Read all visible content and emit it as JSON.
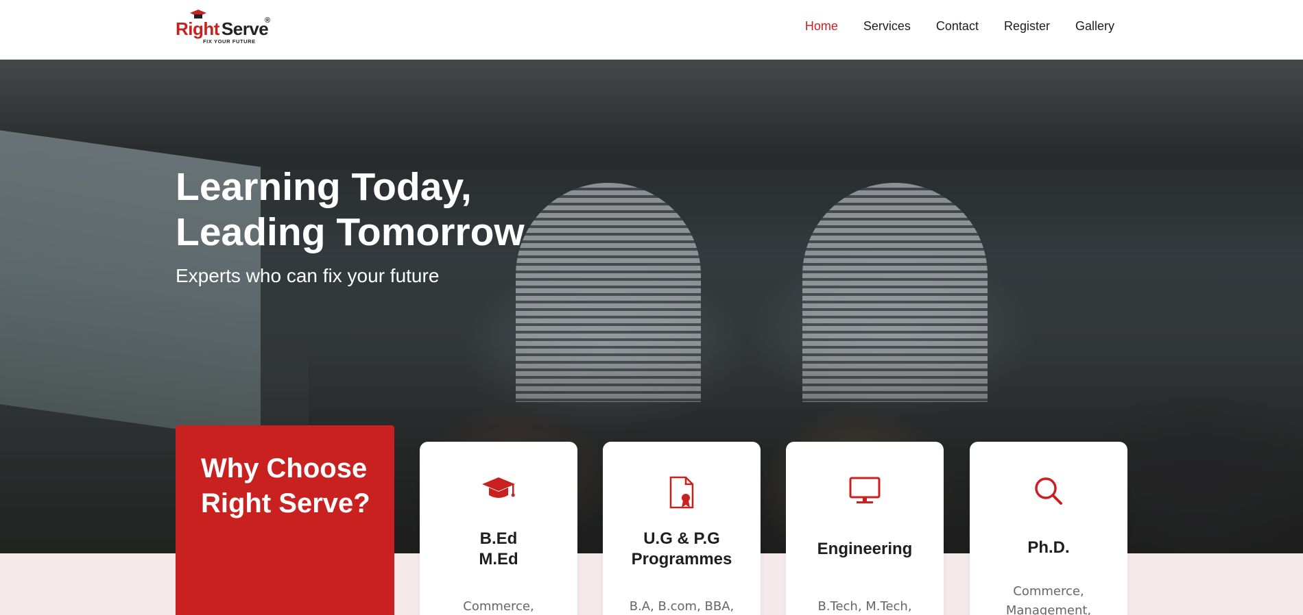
{
  "header": {
    "logo": {
      "word_right": "Right",
      "word_serve": "Serve",
      "registered": "®",
      "tagline": "FIX YOUR FUTURE"
    },
    "nav": [
      {
        "label": "Home",
        "active": true
      },
      {
        "label": "Services",
        "active": false
      },
      {
        "label": "Contact",
        "active": false
      },
      {
        "label": "Register",
        "active": false
      },
      {
        "label": "Gallery",
        "active": false
      }
    ]
  },
  "hero": {
    "title_line1": "Learning Today,",
    "title_line2": "Leading Tomorrow",
    "subtitle": "Experts who can fix your future"
  },
  "why": {
    "title": "Why Choose Right Serve?"
  },
  "cards": [
    {
      "icon": "graduation-cap-icon",
      "title": "B.Ed\nM.Ed",
      "desc": "Commerce,"
    },
    {
      "icon": "certificate-icon",
      "title": "U.G & P.G\nProgrammes",
      "desc": "B.A, B.com, BBA,"
    },
    {
      "icon": "monitor-icon",
      "title": "Engineering",
      "desc": "B.Tech, M.Tech,"
    },
    {
      "icon": "search-icon",
      "title": "Ph.D.",
      "desc": "Commerce,\nManagement,"
    }
  ],
  "colors": {
    "brand_red": "#c8211f",
    "page_bg": "#f5e9ec",
    "text_dark": "#1d1d1d"
  }
}
